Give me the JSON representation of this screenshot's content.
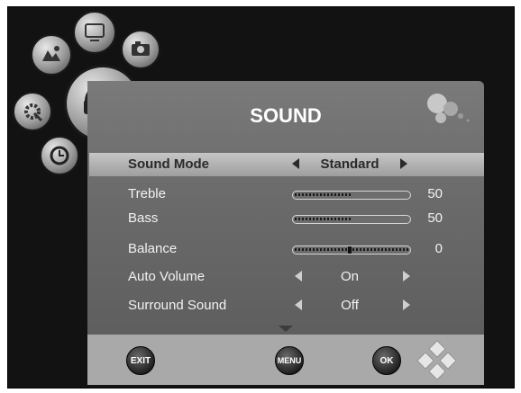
{
  "menu": {
    "title": "SOUND",
    "rows": [
      {
        "label": "Sound Mode",
        "type": "option",
        "value": "Standard",
        "selected": true
      },
      {
        "label": "Treble",
        "type": "slider",
        "value": "50",
        "level": 0.5
      },
      {
        "label": "Bass",
        "type": "slider",
        "value": "50",
        "level": 0.5
      },
      {
        "label": "Balance",
        "type": "balance",
        "value": "0",
        "level": 0.5
      },
      {
        "label": "Auto Volume",
        "type": "option",
        "value": "On"
      },
      {
        "label": "Surround Sound",
        "type": "option",
        "value": "Off"
      }
    ]
  },
  "footer": {
    "exit_label": "EXIT",
    "menu_label": "MENU",
    "ok_label": "OK"
  },
  "icons": [
    "picture-icon",
    "tv-icon",
    "camera-icon",
    "settings-icon",
    "sound-icon",
    "clock-icon",
    "nav-dpad-icon"
  ],
  "colors": {
    "screen_bg": "#121212",
    "panel_bg": "#6a6a6a",
    "selected_bar": "#b0b0b0",
    "footer_bg": "#a9a9a9",
    "text": "#f2f2f2"
  }
}
